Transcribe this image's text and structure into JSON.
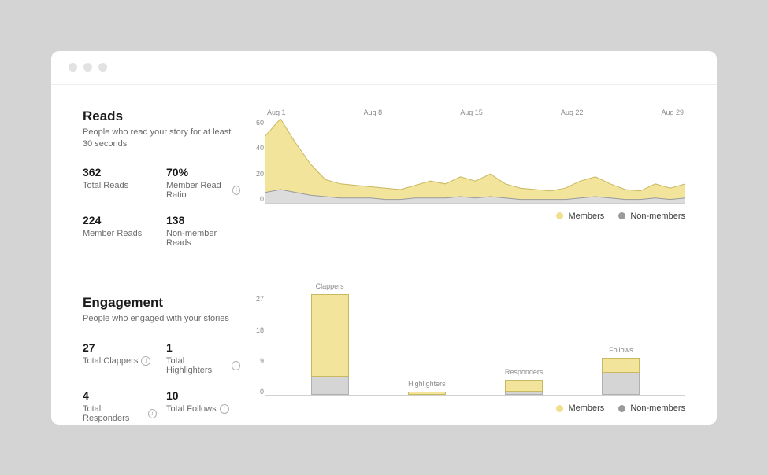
{
  "reads": {
    "title": "Reads",
    "subtitle": "People who read your story for at least 30 seconds",
    "stats": {
      "total_reads": {
        "value": "362",
        "label": "Total Reads"
      },
      "member_ratio": {
        "value": "70%",
        "label": "Member Read Ratio"
      },
      "member_reads": {
        "value": "224",
        "label": "Member Reads"
      },
      "nonmember_reads": {
        "value": "138",
        "label": "Non-member Reads"
      }
    }
  },
  "engagement": {
    "title": "Engagement",
    "subtitle": "People who engaged with your stories",
    "stats": {
      "clappers": {
        "value": "27",
        "label": "Total Clappers"
      },
      "highlighters": {
        "value": "1",
        "label": "Total Highlighters"
      },
      "responders": {
        "value": "4",
        "label": "Total Responders"
      },
      "follows": {
        "value": "10",
        "label": "Total Follows"
      }
    }
  },
  "legend": {
    "members": "Members",
    "nonmembers": "Non-members"
  },
  "chart_data": [
    {
      "type": "area",
      "title": "Reads",
      "xlabel": "",
      "ylabel": "",
      "x_tick_labels": [
        "Aug 1",
        "Aug 8",
        "Aug 15",
        "Aug 22",
        "Aug 29"
      ],
      "y_ticks": [
        60,
        40,
        20,
        0
      ],
      "ylim": [
        0,
        60
      ],
      "x": [
        1,
        2,
        3,
        4,
        5,
        6,
        7,
        8,
        9,
        10,
        11,
        12,
        13,
        14,
        15,
        16,
        17,
        18,
        19,
        20,
        21,
        22,
        23,
        24,
        25,
        26,
        27,
        28,
        29
      ],
      "series": [
        {
          "name": "Members",
          "values": [
            40,
            50,
            35,
            22,
            12,
            10,
            9,
            8,
            8,
            7,
            9,
            12,
            10,
            14,
            12,
            16,
            10,
            8,
            7,
            6,
            8,
            12,
            14,
            10,
            7,
            6,
            10,
            8,
            10
          ]
        },
        {
          "name": "Non-members",
          "values": [
            8,
            10,
            8,
            6,
            5,
            4,
            4,
            4,
            3,
            3,
            4,
            4,
            4,
            5,
            4,
            5,
            4,
            3,
            3,
            3,
            3,
            4,
            5,
            4,
            3,
            3,
            4,
            3,
            4
          ]
        }
      ]
    },
    {
      "type": "bar",
      "title": "Engagement",
      "xlabel": "",
      "ylabel": "",
      "categories": [
        "Clappers",
        "Highlighters",
        "Responders",
        "Follows"
      ],
      "y_ticks": [
        27,
        18,
        9,
        0
      ],
      "ylim": [
        0,
        27
      ],
      "series": [
        {
          "name": "Members",
          "values": [
            22,
            1,
            3,
            4
          ]
        },
        {
          "name": "Non-members",
          "values": [
            5,
            0,
            1,
            6
          ]
        }
      ]
    }
  ]
}
